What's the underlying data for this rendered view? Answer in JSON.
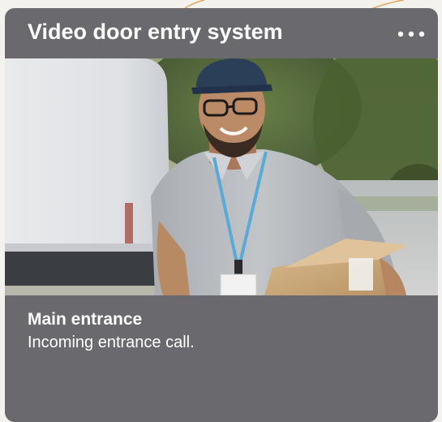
{
  "card": {
    "title": "Video door entry system",
    "menu_icon": "more-horizontal-icon"
  },
  "camera_view": {
    "image": "front-door-camera-snapshot"
  },
  "call": {
    "title": "Main entrance",
    "message": "Incoming entrance call."
  },
  "colors": {
    "card_background": "#6a6a6e",
    "text": "#ffffff",
    "accent_lines": "#e0a860"
  }
}
